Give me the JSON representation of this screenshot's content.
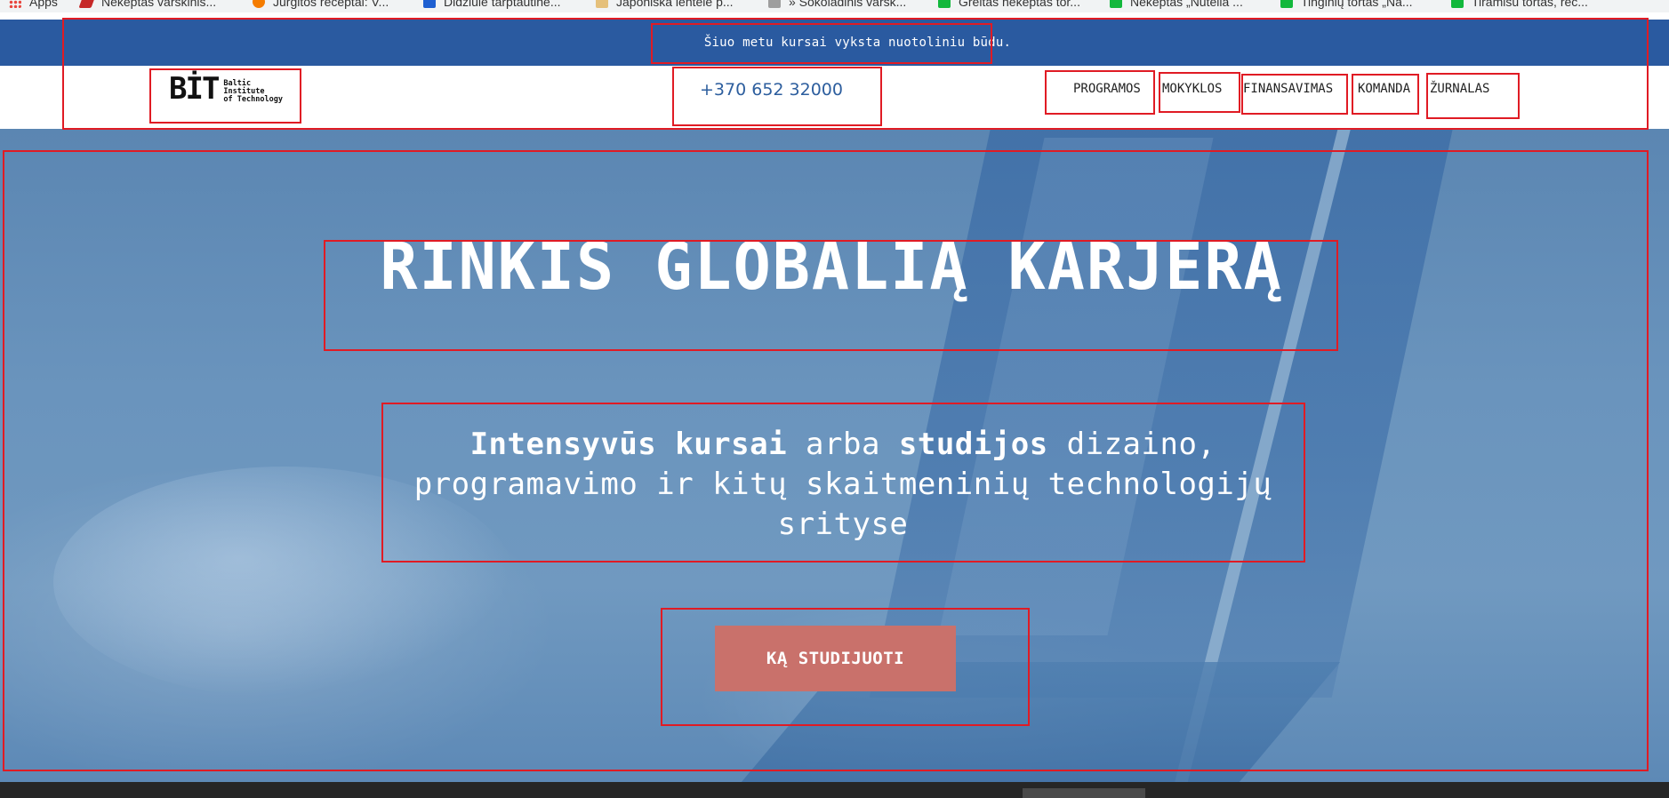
{
  "bookmarks": [
    {
      "label": "Apps",
      "icon": "apps-grid-icon"
    },
    {
      "label": "Nekeptas varškinis...",
      "icon": "bookmark-site-icon"
    },
    {
      "label": "Jurgitos receptai: V...",
      "icon": "blogger-icon"
    },
    {
      "label": "Didžiulė tarptautinė...",
      "icon": "bookmark-site-icon"
    },
    {
      "label": "Japoniška lentelė p...",
      "icon": "bookmark-site-icon"
    },
    {
      "label": "» Šokoladinis varšk...",
      "icon": "bookmark-site-icon"
    },
    {
      "label": "Greitas nekeptas tor...",
      "icon": "bookmark-15min-icon"
    },
    {
      "label": "Nekeptas „Nutella ...",
      "icon": "bookmark-15min-icon"
    },
    {
      "label": "Tinginių tortas „Na...",
      "icon": "bookmark-15min-icon"
    },
    {
      "label": "Tiramisu tortas, rec...",
      "icon": "bookmark-15min-icon"
    }
  ],
  "announcement": {
    "text": "Šiuo metu kursai vyksta nuotoliniu būdu."
  },
  "header": {
    "logo": {
      "mark": "BİT",
      "line1": "Baltic",
      "line2": "Institute",
      "line3": "of Technology"
    },
    "phone": "+370 652 32000",
    "nav": [
      "PROGRAMOS",
      "MOKYKLOS",
      "FINANSAVIMAS",
      "KOMANDA",
      "ŽURNALAS"
    ]
  },
  "hero": {
    "title": "RINKIS GLOBALIĄ KARJERĄ",
    "subtitle": {
      "bold1": "Intensyvūs kursai",
      "text1": " arba ",
      "bold2": "studijos",
      "text2": " dizaino, programavimo ir kitų skaitmeninių technologijų srityse"
    },
    "cta_label": "KĄ STUDIJUOTI"
  },
  "colors": {
    "announcement_bg": "#2a5aa0",
    "phone_text": "#2d5e9e",
    "cta_bg": "#c9716b",
    "annotation_box": "#e01b24"
  }
}
